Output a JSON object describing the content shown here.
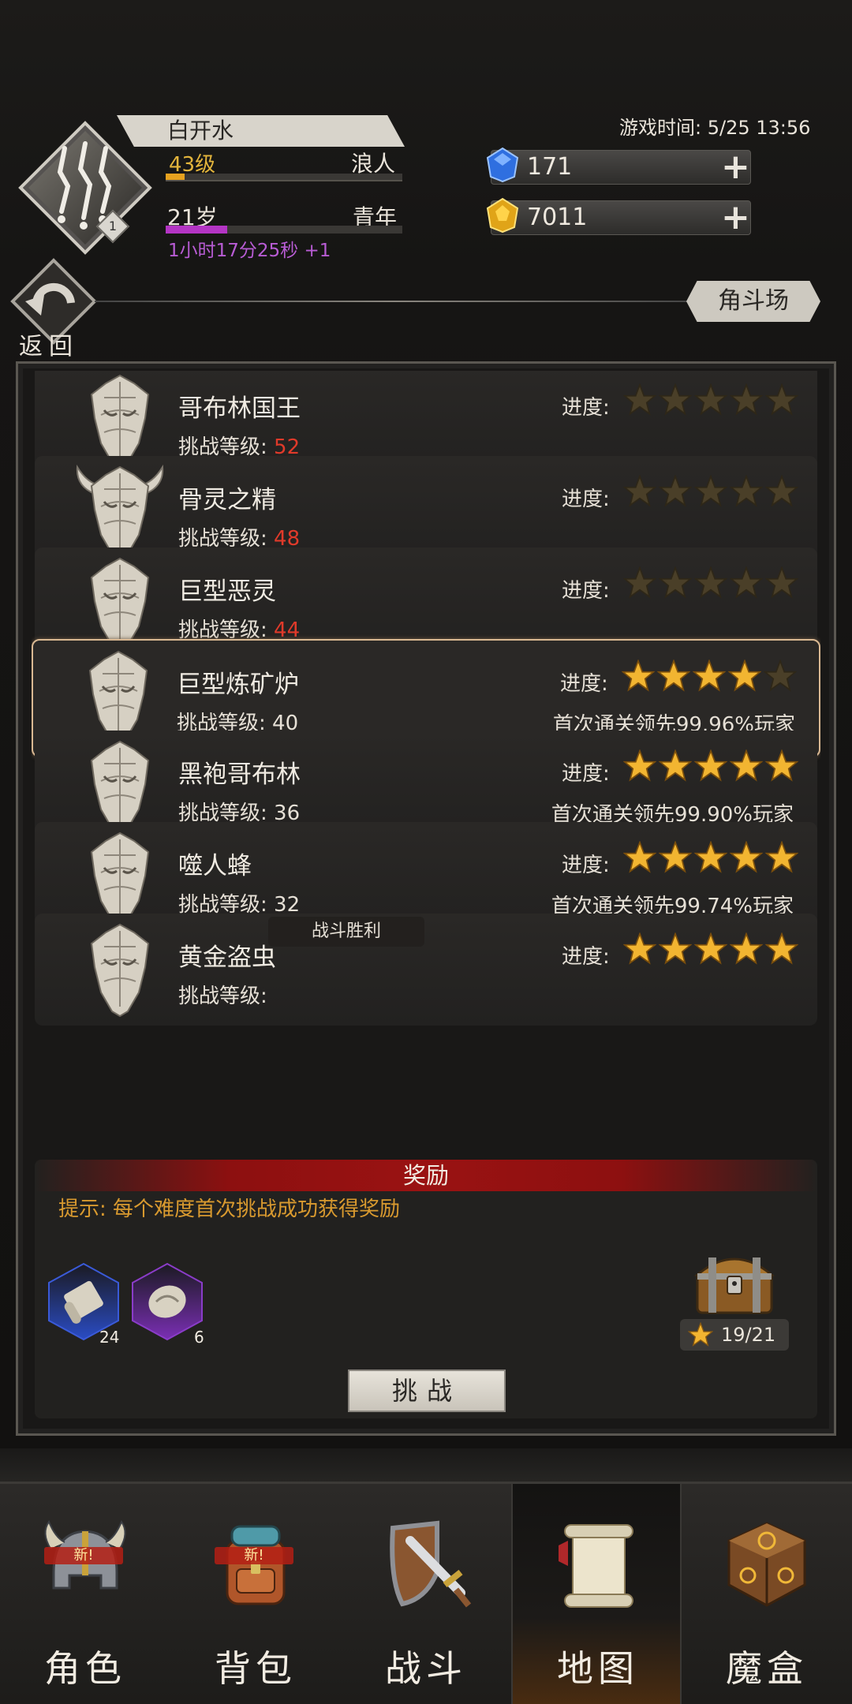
{
  "player": {
    "name": "白开水",
    "level": "43级",
    "class": "浪人",
    "level_badge": "1",
    "exp_progress": 0.08,
    "age": "21岁",
    "stage": "青年",
    "age_progress": 0.26,
    "timer": "1小时17分25秒 +1"
  },
  "game_time": "游戏时间: 5/25 13:56",
  "resources": {
    "gems": "171",
    "gold": "7011"
  },
  "nav_header": {
    "back_label": "返回",
    "arena_label": "角斗场"
  },
  "labels": {
    "progress": "进度:",
    "challenge_level": "挑战等级: "
  },
  "bosses": [
    {
      "name": "哥布林国王",
      "level": "52",
      "level_red": true,
      "stars": 0,
      "lead": ""
    },
    {
      "name": "骨灵之精",
      "level": "48",
      "level_red": true,
      "stars": 0,
      "lead": ""
    },
    {
      "name": "巨型恶灵",
      "level": "44",
      "level_red": true,
      "stars": 0,
      "lead": ""
    },
    {
      "name": "巨型炼矿炉",
      "level": "40",
      "level_red": false,
      "stars": 4,
      "lead": "首次通关领先99.96%玩家"
    },
    {
      "name": "黑袍哥布林",
      "level": "36",
      "level_red": false,
      "stars": 5,
      "lead": "首次通关领先99.90%玩家"
    },
    {
      "name": "噬人蜂",
      "level": "32",
      "level_red": false,
      "stars": 5,
      "lead": "首次通关领先99.74%玩家"
    },
    {
      "name": "黄金盗虫",
      "level": "",
      "level_red": false,
      "stars": 5,
      "lead": ""
    }
  ],
  "toast": "战斗胜利",
  "reward": {
    "title": "奖励",
    "hint": "提示: 每个难度首次挑战成功获得奖励",
    "items": [
      {
        "icon": "scroll-item-icon",
        "count": "24",
        "rarity_color": "#2a4cc4"
      },
      {
        "icon": "mask-item-icon",
        "count": "6",
        "rarity_color": "#7a2fb4"
      }
    ],
    "star_total": "19/21",
    "challenge_label": "挑战"
  },
  "nav": [
    {
      "label": "角色",
      "icon": "helmet-icon",
      "new": true,
      "new_label": "新!"
    },
    {
      "label": "背包",
      "icon": "backpack-icon",
      "new": true,
      "new_label": "新!"
    },
    {
      "label": "战斗",
      "icon": "sword-shield-icon",
      "new": false
    },
    {
      "label": "地图",
      "icon": "map-scroll-icon",
      "new": false,
      "active": true
    },
    {
      "label": "魔盒",
      "icon": "magic-cube-icon",
      "new": false
    }
  ],
  "colors": {
    "accent_gold": "#e3b53c",
    "level_red": "#e03a2a",
    "star_gold": "#f2b531",
    "reward_banner": "#9a1212",
    "selected_border": "#d9b892"
  }
}
